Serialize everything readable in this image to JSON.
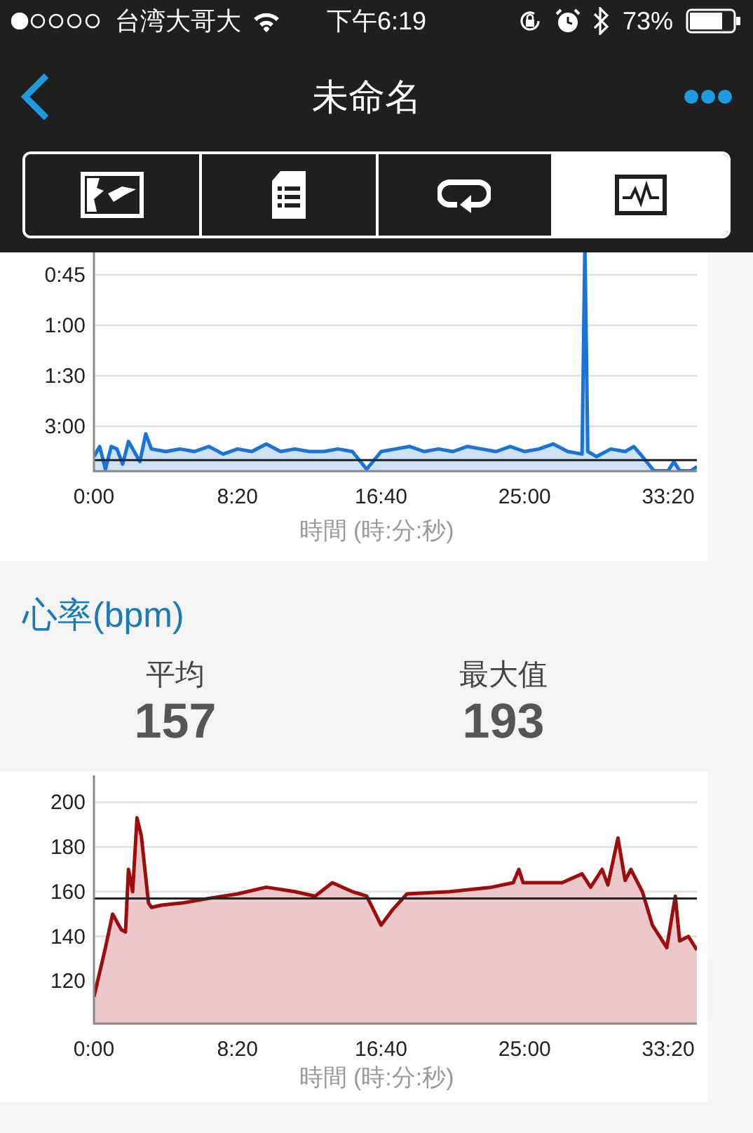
{
  "status_bar": {
    "carrier": "台湾大哥大",
    "time": "下午6:19",
    "battery_text": "73%"
  },
  "nav": {
    "title": "未命名"
  },
  "tabs": [
    {
      "kind": "map",
      "selected": false
    },
    {
      "kind": "details",
      "selected": false
    },
    {
      "kind": "laps",
      "selected": false
    },
    {
      "kind": "charts",
      "selected": true
    }
  ],
  "pace_chart": {
    "xlabel": "時間 (時:分:秒)",
    "y_labels": [
      "0:45",
      "1:00",
      "1:30",
      "3:00"
    ],
    "x_labels": [
      "0:00",
      "8:20",
      "16:40",
      "25:00",
      "33:20"
    ]
  },
  "heart_rate": {
    "title": "心率(bpm)",
    "stats": [
      {
        "label": "平均",
        "value": "157"
      },
      {
        "label": "最大值",
        "value": "193"
      }
    ],
    "chart_data": {
      "type": "area",
      "xlabel": "時間 (時:分:秒)",
      "grid": true,
      "x": [
        0,
        40,
        65,
        95,
        110,
        120,
        135,
        150,
        165,
        190,
        200,
        235,
        310,
        400,
        500,
        600,
        700,
        770,
        830,
        900,
        950,
        1000,
        1040,
        1090,
        1240,
        1385,
        1460,
        1480,
        1495,
        1630,
        1700,
        1730,
        1770,
        1790,
        1825,
        1850,
        1870,
        1910,
        1945,
        1995,
        2025,
        2040,
        2070,
        2100
      ],
      "series": [
        {
          "color": "#9c0d0d",
          "values": [
            113,
            135,
            150,
            143,
            142,
            170,
            160,
            193,
            185,
            155,
            153,
            154,
            155,
            157,
            159,
            162,
            160,
            158,
            164,
            160,
            158,
            145,
            152,
            159,
            160,
            162,
            164,
            170,
            164,
            164,
            168,
            162,
            170,
            163,
            184,
            165,
            170,
            160,
            145,
            135,
            158,
            138,
            140,
            134
          ]
        },
        {
          "type": "line",
          "color": "#222222",
          "values": [
            157,
            157,
            157,
            157,
            157,
            157,
            157,
            157,
            157,
            157,
            157,
            157,
            157,
            157,
            157,
            157,
            157,
            157,
            157,
            157,
            157,
            157,
            157,
            157,
            157,
            157,
            157,
            157,
            157,
            157,
            157,
            157,
            157,
            157,
            157,
            157,
            157,
            157,
            157,
            157,
            157,
            157,
            157,
            157
          ]
        }
      ],
      "xlim": [
        0,
        2100
      ],
      "ylim": [
        101,
        212
      ],
      "xticks": [
        {
          "value": 0,
          "label": "0:00"
        },
        {
          "value": 500,
          "label": "8:20"
        },
        {
          "value": 1000,
          "label": "16:40"
        },
        {
          "value": 1500,
          "label": "25:00"
        },
        {
          "value": 2000,
          "label": "33:20"
        }
      ],
      "yticks": [
        120,
        140,
        160,
        180,
        200
      ]
    }
  }
}
